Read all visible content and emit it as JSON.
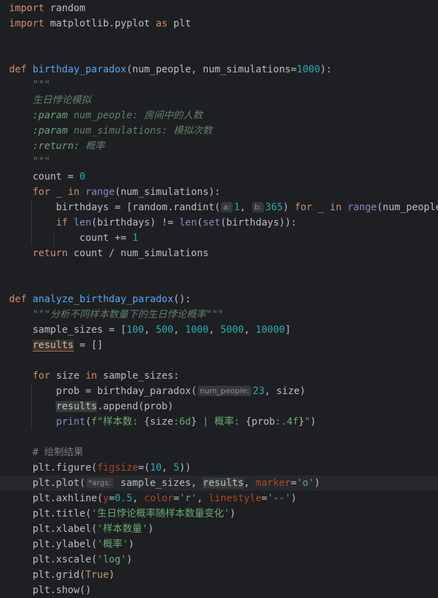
{
  "editor": {
    "lines": {
      "l1": {
        "kw": "import",
        "rest": " random"
      },
      "l2": {
        "kw1": "import",
        "mod": " matplotlib.pyplot ",
        "kw2": "as",
        "rest": " plt"
      },
      "l5": {
        "kw": "def",
        "fn": "birthday_paradox",
        "p1": "(num_people, num_simulations=",
        "num": "1000",
        "p2": "):"
      },
      "l6": {
        "doc": "\"\"\""
      },
      "l7": {
        "doc": "生日悖论模拟"
      },
      "l8": {
        "tag": ":param",
        "name": " num_people:",
        "desc": " 房间中的人数"
      },
      "l9": {
        "tag": ":param",
        "name": " num_simulations:",
        "desc": " 模拟次数"
      },
      "l10": {
        "tag": ":return:",
        "desc": " 概率"
      },
      "l11": {
        "doc": "\"\"\""
      },
      "l12": {
        "a": "count = ",
        "num": "0"
      },
      "l13": {
        "kw1": "for",
        "a": " _ ",
        "kw2": "in",
        "b": " ",
        "bi": "range",
        "c": "(num_simulations):"
      },
      "l14": {
        "a": "birthdays = [random.randint(",
        "hint1": "a:",
        "num1": "1",
        "b": ", ",
        "hint2": "b:",
        "num2": "365",
        "c": ") ",
        "kw1": "for",
        "d": " _ ",
        "kw2": "in",
        "e": " ",
        "bi": "range",
        "f": "(num_people)]"
      },
      "l15": {
        "kw": "if",
        "a": " ",
        "bi1": "len",
        "b": "(birthdays) != ",
        "bi2": "len",
        "c": "(",
        "bi3": "set",
        "d": "(birthdays)):"
      },
      "l16": {
        "a": "count += ",
        "num": "1"
      },
      "l17": {
        "kw": "return",
        "rest": " count / num_simulations"
      },
      "l20": {
        "kw": "def",
        "fn": "analyze_birthday_paradox",
        "rest": "():"
      },
      "l21": {
        "doc": "\"\"\"分析不同样本数量下的生日悖论概率\"\"\""
      },
      "l22": {
        "a": "sample_sizes = [",
        "n1": "100",
        "n2": "500",
        "n3": "1000",
        "n4": "5000",
        "n5": "10000",
        "sep": ", ",
        "b": "]"
      },
      "l23": {
        "var": "results",
        "rest": " = []"
      },
      "l25": {
        "kw1": "for",
        "a": " size ",
        "kw2": "in",
        "b": " sample_sizes:"
      },
      "l26": {
        "a": "prob = birthday_paradox(",
        "hint": "num_people:",
        "num": "23",
        "b": ", size)"
      },
      "l27": {
        "var": "results",
        "rest": ".append(prob)"
      },
      "l28": {
        "bi": "print",
        "a": "(",
        "s1": "f\"样本数: ",
        "b": "{size",
        "s2": ":6d",
        "c": "}",
        "s3": " | 概率: ",
        "d": "{prob",
        "s4": ":.4f",
        "e": "}",
        "s5": "\"",
        "f": ")"
      },
      "l30": {
        "cmt": "# 绘制结果"
      },
      "l31": {
        "a": "plt.figure(",
        "kw": "figsize",
        "b": "=(",
        "n1": "10",
        "c": ", ",
        "n2": "5",
        "d": "))"
      },
      "l32": {
        "a": "plt.plot(",
        "hint": "*args:",
        "b": " sample_sizes, ",
        "var": "results",
        "c": ", ",
        "kw": "marker",
        "d": "=",
        "str": "'o'",
        "e": ")"
      },
      "l33": {
        "a": "plt.axhline(",
        "kw1": "y",
        "b": "=",
        "num": "0.5",
        "c": ", ",
        "kw2": "color",
        "d": "=",
        "s1": "'r'",
        "e": ", ",
        "kw3": "linestyle",
        "f": "=",
        "s2": "'--'",
        "g": ")"
      },
      "l34": {
        "a": "plt.title(",
        "str": "'生日悖论概率随样本数量变化'",
        "b": ")"
      },
      "l35": {
        "a": "plt.xlabel(",
        "str": "'样本数量'",
        "b": ")"
      },
      "l36": {
        "a": "plt.ylabel(",
        "str": "'概率'",
        "b": ")"
      },
      "l37": {
        "a": "plt.xscale(",
        "str": "'log'",
        "b": ")"
      },
      "l38": {
        "a": "plt.grid(",
        "kw": "True",
        "b": ")"
      },
      "l39": {
        "a": "plt.show()"
      }
    }
  },
  "colors": {
    "background": "#1e1f22",
    "keyword": "#cf8e6d",
    "function": "#56a8f5",
    "number": "#2aacb8",
    "string": "#6aab73",
    "docstring": "#5f826b",
    "kwarg": "#aa4926"
  }
}
